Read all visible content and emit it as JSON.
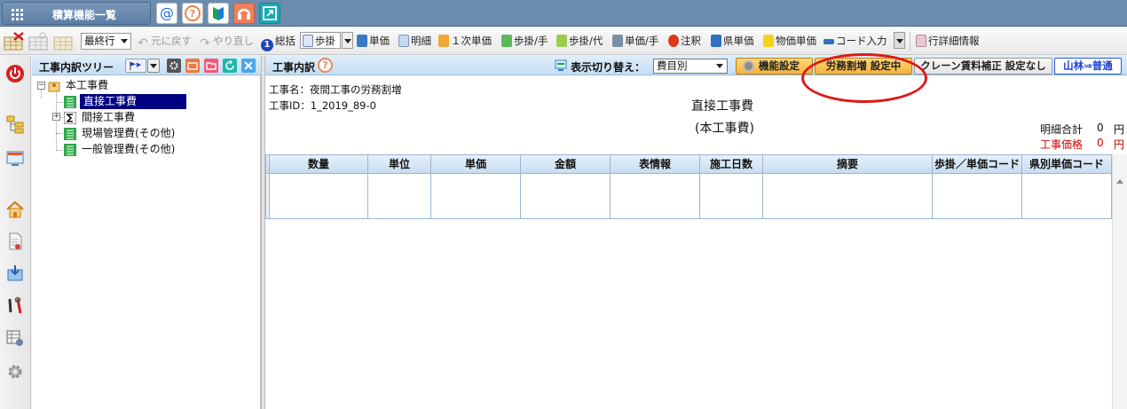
{
  "topbar": {
    "menu_label": "積算機能一覧",
    "icons": [
      "at-icon",
      "question-icon",
      "beginner-icon",
      "support-icon",
      "expand-icon"
    ],
    "at_glyph": "@",
    "question_glyph": "?"
  },
  "toolbar": {
    "select_value": "最終行",
    "undo": "元に戻す",
    "redo": "やり直し",
    "summary": "総括",
    "step": "歩掛",
    "unit_price": "単価",
    "detail": "明細",
    "primary_unit_price": "１次単価",
    "step_hand": "歩掛/手",
    "step_sub": "歩掛/代",
    "unit_price_hand": "単価/手",
    "note": "注釈",
    "prefecture_price": "県単価",
    "goods_price": "物価単価",
    "code_input": "コード入力",
    "row_detail": "行詳細情報"
  },
  "tree": {
    "title": "工事内訳ツリー",
    "nodes": [
      {
        "label": "本工事費"
      },
      {
        "label": "直接工事費"
      },
      {
        "label": "間接工事費"
      },
      {
        "label": "現場管理費(その他)"
      },
      {
        "label": "一般管理費(その他)"
      }
    ]
  },
  "main": {
    "title": "工事内訳",
    "help_glyph": "?",
    "switch_label": "表示切り替え：",
    "switch_value": "費目別",
    "btn_function": "機能設定",
    "btn_labor": "労務割増 設定中",
    "btn_crane": "クレーン賃料補正 設定なし",
    "btn_forest": "山林⇒普通",
    "project_name": "工事名：夜間工事の労務割増",
    "project_id": "工事ID：1_2019_89-0",
    "doc_title": "直接工事費",
    "doc_subtitle": "(本工事費)",
    "sum_label": "明細合計",
    "sum_value": "0",
    "sum_unit": "円",
    "price_label": "工事価格",
    "price_value": "0",
    "price_unit": "円",
    "columns": [
      "数量",
      "単位",
      "単価",
      "金額",
      "表情報",
      "施工日数",
      "摘要",
      "歩掛／単価コード",
      "県別単価コード"
    ]
  },
  "colors": {
    "topbar": "#6b8cae",
    "selection": "#000080",
    "highlight_button": "#f5b33a",
    "annotation": "#e01818",
    "price_red": "#d00000"
  }
}
